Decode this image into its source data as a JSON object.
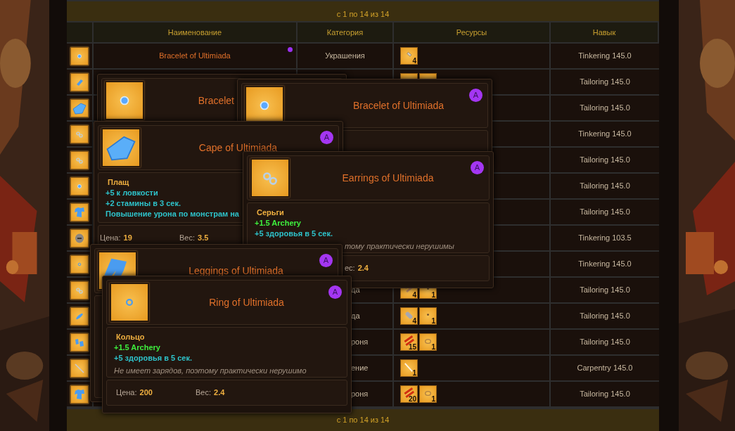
{
  "pagination_top": "с 1 по 14 из 14",
  "table": {
    "columns": [
      "Наименование",
      "Категория",
      "Ресурсы",
      "Навык"
    ],
    "rows": [
      {
        "name": "Bracelet of Ultimiada",
        "color": "#9b30f0",
        "category": "Украшения",
        "resources": [
          {
            "kind": "nail",
            "count": "4"
          }
        ],
        "skill": "Tinkering 145.0"
      },
      {
        "resources": [
          {
            "kind": "item"
          },
          {
            "kind": "item"
          }
        ],
        "skill": "Tailoring 145.0"
      },
      {
        "skill": "Tailoring 145.0"
      },
      {
        "skill": "Tinkering 145.0"
      },
      {
        "skill": "Tailoring 145.0"
      },
      {
        "skill": "Tailoring 145.0"
      },
      {
        "skill": "Tailoring 145.0"
      },
      {
        "skill": "Tinkering 103.5"
      },
      {
        "skill": "Tinkering 145.0"
      },
      {
        "category": "да",
        "resources": [
          {
            "kind": "leather",
            "count": "4"
          },
          {
            "kind": "thread",
            "count": "1"
          }
        ],
        "skill": "Tailoring 145.0"
      },
      {
        "category": "да",
        "resources": [
          {
            "kind": "bone",
            "count": "4"
          },
          {
            "kind": "thread",
            "count": "1"
          }
        ],
        "skill": "Tailoring 145.0"
      },
      {
        "category": "роня",
        "resources": [
          {
            "kind": "cloth",
            "count": "15"
          },
          {
            "kind": "spool",
            "count": "1"
          }
        ],
        "skill": "Tailoring 145.0"
      },
      {
        "category": "ение",
        "resources": [
          {
            "kind": "board",
            "count": "1"
          }
        ],
        "skill": "Carpentry 145.0"
      },
      {
        "category": "роня",
        "resources": [
          {
            "kind": "cloth",
            "count": "20"
          },
          {
            "kind": "spool",
            "count": "1"
          }
        ],
        "skill": "Tailoring 145.0"
      }
    ]
  },
  "tooltips": [
    {
      "title": "Bracelet"
    },
    {
      "title": "Bracelet of Ultimiada",
      "badge": "A"
    },
    {
      "title": "Cape of Ultimiada",
      "badge": "A",
      "type": "Плащ",
      "stats": [
        {
          "kind": "effect",
          "text": "+5 к ловкости"
        },
        {
          "kind": "effect",
          "text": "+2 стамины в 3 сек."
        },
        {
          "kind": "effect",
          "text": "Повышение урона по монстрам на"
        }
      ],
      "footer": [
        {
          "label": "Цена:",
          "value": "19"
        },
        {
          "label": "Вес:",
          "value": "3.5"
        }
      ]
    },
    {
      "title": "Earrings of Ultimiada",
      "badge": "A",
      "type": "Серьги",
      "stats": [
        {
          "kind": "skill",
          "text": "+1.5 Archery"
        },
        {
          "kind": "effect",
          "text": "+5 здоровья в 5 сек."
        }
      ],
      "note": "тому практически нерушимы",
      "footer": [
        {
          "label": "ес:",
          "value": "2.4"
        }
      ]
    },
    {
      "title": "Leggings of Ultimiada",
      "badge": "A"
    },
    {
      "title": "Ring of Ultimiada",
      "badge": "A",
      "type": "Кольцо",
      "stats": [
        {
          "kind": "skill",
          "text": "+1.5 Archery"
        },
        {
          "kind": "effect",
          "text": "+5 здоровья в 5 сек."
        }
      ],
      "note": "Не имеет зарядов, поэтому практически нерушимо",
      "footer": [
        {
          "label": "Цена:",
          "value": "200"
        },
        {
          "label": "Вес:",
          "value": "2.4"
        }
      ]
    }
  ],
  "pagination_bottom": "с 1 по 14 из 14"
}
